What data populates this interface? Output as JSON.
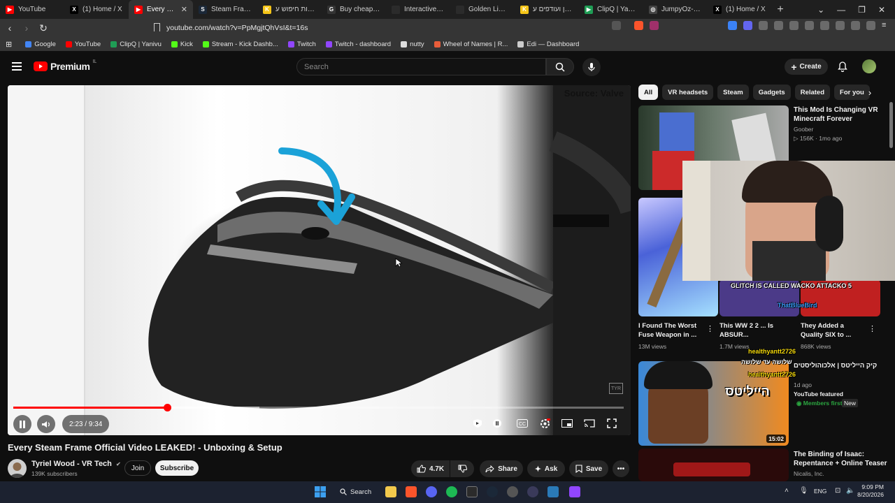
{
  "browser": {
    "tabs": [
      {
        "label": "YouTube",
        "fav_color": "#ff0000",
        "fav_glyph": "▶"
      },
      {
        "label": "(1) Home / X",
        "fav_color": "#000000",
        "fav_glyph": "X"
      },
      {
        "label": "Every Ste",
        "fav_color": "#ff0000",
        "fav_glyph": "▶",
        "active": true
      },
      {
        "label": "Steam Frame",
        "fav_color": "#1b2838",
        "fav_glyph": "S"
      },
      {
        "label": "תוצאות חיפוש ע",
        "fav_color": "#f5c518",
        "fav_glyph": "K"
      },
      {
        "label": "Buy cheap META",
        "fav_color": "#333333",
        "fav_glyph": "G"
      },
      {
        "label": "Interactive Map",
        "fav_color": "#2b2b2b",
        "fav_glyph": ""
      },
      {
        "label": "Golden Lineage",
        "fav_color": "#2b2b2b",
        "fav_glyph": ""
      },
      {
        "label": "מציאון ועודפים ע",
        "fav_color": "#f5c518",
        "fav_glyph": "K"
      },
      {
        "label": "ClipQ | Yanivu",
        "fav_color": "#1f9d55",
        "fav_glyph": "▶"
      },
      {
        "label": "JumpyOz-ezgif.c",
        "fav_color": "#444444",
        "fav_glyph": "◎"
      },
      {
        "label": "(1) Home / X",
        "fav_color": "#000000",
        "fav_glyph": "X"
      }
    ],
    "new_tab": "+",
    "url": "youtube.com/watch?v=PpMgjtQhVsI&t=16s",
    "bookmarks": [
      {
        "label": "Google",
        "color": "#4285f4"
      },
      {
        "label": "YouTube",
        "color": "#ff0000"
      },
      {
        "label": "ClipQ | Yanivu",
        "color": "#1f9d55"
      },
      {
        "label": "Kick",
        "color": "#53fc18"
      },
      {
        "label": "Stream - Kick Dashb...",
        "color": "#53fc18"
      },
      {
        "label": "Twitch",
        "color": "#9146ff"
      },
      {
        "label": "Twitch - dashboard",
        "color": "#9146ff"
      },
      {
        "label": "nutty",
        "color": "#dddddd"
      },
      {
        "label": "Wheel of Names | R...",
        "color": "#e85d3a"
      },
      {
        "label": "Edi — Dashboard",
        "color": "#cccccc"
      }
    ]
  },
  "youtube": {
    "logo_text": "Premium",
    "logo_region": "IL",
    "search_placeholder": "Search",
    "create_label": "Create"
  },
  "video": {
    "overlay_text": "Source: Valve",
    "watermark": "TYR",
    "time": "2:23 / 9:34",
    "progress_fraction": 0.252,
    "buffered_fraction": 0.403,
    "title": "Every Steam Frame Official Video LEAKED! - Unboxing & Setup",
    "channel": "Tyriel Wood - VR Tech",
    "verified": "✔",
    "subscribers": "139K subscribers",
    "join_label": "Join",
    "subscribe_label": "Subscribe",
    "likes": "4.7K",
    "share_label": "Share",
    "ask_label": "Ask",
    "save_label": "Save"
  },
  "chips": [
    "All",
    "VR headsets",
    "Steam",
    "Gadgets",
    "Related",
    "For you"
  ],
  "recommendations": [
    {
      "title": "This Mod Is Changing VR Minecraft Forever",
      "channel": "Goober",
      "meta": "156K · 1mo ago"
    },
    {
      "title": "I Found The Worst Fuse Weapon in ...",
      "meta": "13M views"
    },
    {
      "title": "This WW 2 2 ... Is ABSUR...",
      "meta": "1.7M views"
    },
    {
      "title": "They Added a Quality SIX to ...",
      "meta": "868K views"
    },
    {
      "title": "קיק הייליטס | אלכוהוליסטים",
      "meta": "1d ago",
      "badge1": "YouTube featured",
      "badge2": "Members first",
      "badge3": "New",
      "duration": "15:02",
      "thumb_text": "הייליטס"
    },
    {
      "title": "The Binding of Isaac: Repentance + Online Teaser",
      "channel": "Nicalis, Inc."
    }
  ],
  "overlay_chat": [
    {
      "user": "healthyantt2726",
      "color": "#f5d90a"
    },
    {
      "user": "ThatBlueBird",
      "color": "#3aa0ff"
    },
    {
      "text": "שלושה עד שלושה",
      "color": "#ffffff"
    },
    {
      "user": "healthyantt2726",
      "color": "#f5d90a"
    },
    {
      "text": "5 GLITCH IS CALLED WACKO ATTACKO",
      "color": "#ffffff"
    }
  ],
  "taskbar": {
    "search_label": "Search",
    "language": "ENG",
    "time": "9:09 PM",
    "date": "8/20/2026"
  },
  "colors": {
    "accent": "#ff0000",
    "background": "#0f0f0f",
    "chip": "#272727"
  }
}
